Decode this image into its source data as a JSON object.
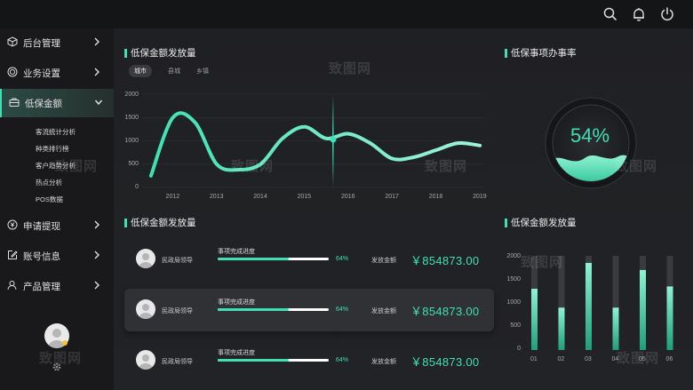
{
  "sidebar": {
    "items": [
      {
        "label": "后台管理",
        "icon": "cube-icon"
      },
      {
        "label": "业务设置",
        "icon": "target-icon"
      },
      {
        "label": "低保金额",
        "icon": "briefcase-icon"
      },
      {
        "label": "申请提现",
        "icon": "yen-circle-icon"
      },
      {
        "label": "账号信息",
        "icon": "edit-icon"
      },
      {
        "label": "产品管理",
        "icon": "user-icon"
      }
    ],
    "subitems": [
      "客流统计分析",
      "种类排行榜",
      "客户趋势分析",
      "热点分析",
      "POS数据"
    ]
  },
  "line_panel": {
    "title": "低保金额发放量",
    "tabs": [
      "城市",
      "县城",
      "乡镇"
    ],
    "active_tab": 0
  },
  "gauge_panel": {
    "title": "低保事项办事率",
    "value_text": "54%",
    "fraction": 0.54
  },
  "list_panel": {
    "title": "低保金额发放量",
    "rows": [
      {
        "who": "民政局领导",
        "progress_label": "事项完成进度",
        "progress": 0.64,
        "pct": "64%",
        "amount_label": "发放金额",
        "amount": "￥854873.00"
      },
      {
        "who": "民政局领导",
        "progress_label": "事项完成进度",
        "progress": 0.64,
        "pct": "64%",
        "amount_label": "发放金额",
        "amount": "￥854873.00"
      },
      {
        "who": "民政局领导",
        "progress_label": "事项完成进度",
        "progress": 0.64,
        "pct": "64%",
        "amount_label": "发放金额",
        "amount": "￥854873.00"
      }
    ]
  },
  "bar_panel": {
    "title": "低保金额发放量"
  },
  "watermark": "致图网",
  "colors": {
    "accent": "#3fe0b5",
    "background": "#1f2023",
    "sidebar": "#19191c",
    "topbar": "#141517"
  },
  "chart_data": [
    {
      "type": "line",
      "x": [
        2011.5,
        2012,
        2012.5,
        2013,
        2013.5,
        2014,
        2014.5,
        2015,
        2015.5,
        2016,
        2016.5,
        2017,
        2017.5,
        2018,
        2018.5,
        2019
      ],
      "values": [
        250,
        1500,
        1400,
        500,
        380,
        500,
        1050,
        1300,
        1050,
        1150,
        950,
        620,
        650,
        800,
        950,
        900
      ],
      "yticks": [
        "0",
        "500",
        "1000",
        "1500",
        "2000"
      ],
      "xticks": [
        "2012",
        "2013",
        "2014",
        "2015",
        "2016",
        "2017",
        "2018",
        "2019"
      ],
      "ylim": [
        0,
        2000
      ],
      "xlim": [
        2011.3,
        2019.1
      ]
    },
    {
      "type": "bar",
      "categories": [
        "01",
        "02",
        "03",
        "04",
        "05",
        "06"
      ],
      "values": [
        1300,
        900,
        1850,
        900,
        1700,
        1350
      ],
      "track_values": [
        2000,
        2000,
        2000,
        2000,
        2000,
        2000
      ],
      "yticks": [
        "0",
        "500",
        "1000",
        "1500",
        "2000"
      ],
      "ylim": [
        0,
        2000
      ]
    }
  ]
}
